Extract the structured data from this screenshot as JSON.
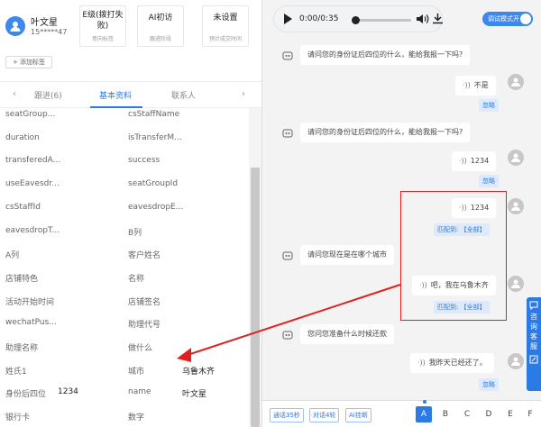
{
  "customer": {
    "name": "叶文星",
    "phone": "15*****47"
  },
  "stats": [
    {
      "value": "E级(拨打失败)",
      "label": "意向标签"
    },
    {
      "value": "AI初访",
      "label": "跟进阶段"
    },
    {
      "value": "未设置",
      "label": "预计成交时间"
    }
  ],
  "add_tag_label": "+ 添加标签",
  "tabs": [
    {
      "label": "跟进(6)",
      "active": false
    },
    {
      "label": "基本资料",
      "active": true
    },
    {
      "label": "联系人",
      "active": false
    }
  ],
  "fields": [
    {
      "k1": "seatGroup...",
      "v1": "",
      "k2": "csStaffName",
      "v2": ""
    },
    {
      "k1": "duration",
      "v1": "",
      "k2": "isTransferM...",
      "v2": ""
    },
    {
      "k1": "transferedA...",
      "v1": "",
      "k2": "success",
      "v2": ""
    },
    {
      "k1": "useEavesdr...",
      "v1": "",
      "k2": "seatGroupId",
      "v2": ""
    },
    {
      "k1": "csStaffId",
      "v1": "",
      "k2": "eavesdropE...",
      "v2": ""
    },
    {
      "k1": "eavesdropT...",
      "v1": "",
      "k2": "B列",
      "v2": ""
    },
    {
      "k1": "A列",
      "v1": "",
      "k2": "客户姓名",
      "v2": ""
    },
    {
      "k1": "店铺特色",
      "v1": "",
      "k2": "名称",
      "v2": ""
    },
    {
      "k1": "活动开始时间",
      "v1": "",
      "k2": "店铺签名",
      "v2": ""
    },
    {
      "k1": "wechatPus...",
      "v1": "",
      "k2": "助理代号",
      "v2": ""
    },
    {
      "k1": "助理名称",
      "v1": "",
      "k2": "做什么",
      "v2": ""
    },
    {
      "k1": "姓氏1",
      "v1": "",
      "k2": "城市",
      "v2": "乌鲁木齐"
    },
    {
      "k1": "身份后四位",
      "v1": "1234",
      "k2": "name",
      "v2": "叶文星"
    },
    {
      "k1": "银行卡",
      "v1": "",
      "k2": "数字",
      "v2": ""
    }
  ],
  "audio": {
    "time": "0:00/0:35"
  },
  "debug_toggle": {
    "label": "调试模式开",
    "on": true
  },
  "chat": {
    "bot1": "请问您的身份证后四位的什么，能给我报一下吗?",
    "user1": "不是",
    "tag1": "忽略",
    "bot2": "请问您的身份证后四位的什么，能给我报一下吗?",
    "user2": "1234",
    "tag2": "忽略",
    "user3": "1234",
    "match_prefix": "匹配到:",
    "match_value": "【全部】",
    "bot3": "请问您现在是在哪个城市",
    "user4": "吧，我在乌鲁木齐",
    "bot4": "您问您准备什么时候还款",
    "user5": "我昨天已经还了。",
    "tag5": "忽略"
  },
  "side_float": {
    "chars": [
      "咨",
      "询",
      "客",
      "服"
    ]
  },
  "bottom": {
    "buttons": [
      "通话35秒",
      "对话4轮",
      "AI挂断"
    ],
    "letters": [
      "A",
      "B",
      "C",
      "D",
      "E",
      "F"
    ],
    "active_letter": "A"
  },
  "colors": {
    "accent": "#2c7be5",
    "annotation": "#e02020"
  }
}
